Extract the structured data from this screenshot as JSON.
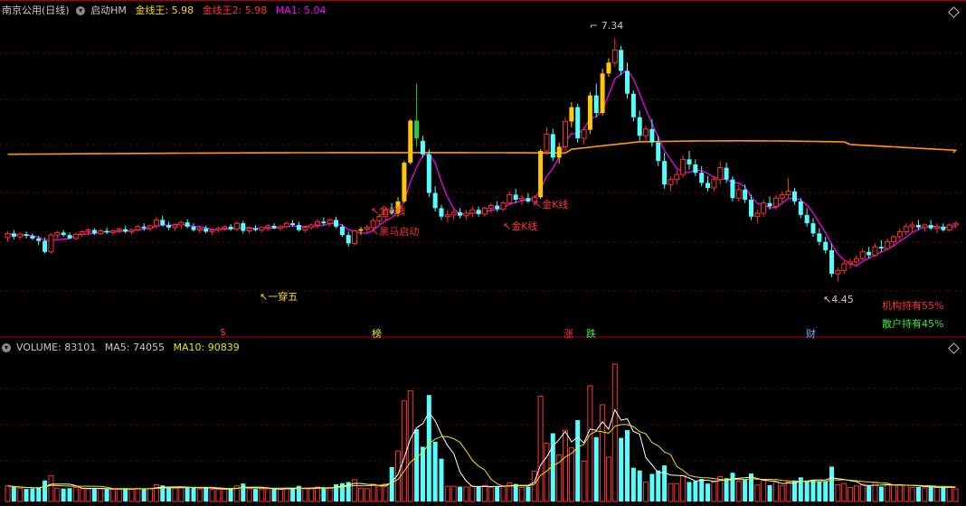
{
  "header": {
    "stock_name": "南京公用(日线)",
    "indicator_name": "启动HM",
    "jxw_label": "金线王:",
    "jxw_value": "5.98",
    "jxw2_label": "金线王2:",
    "jxw2_value": "5.98",
    "ma1_label": "MA1:",
    "ma1_value": "5.04"
  },
  "volume_header": {
    "volume_label": "VOLUME:",
    "volume_value": "83101",
    "ma5_label": "MA5:",
    "ma5_value": "74055",
    "ma10_label": "MA10:",
    "ma10_value": "90839"
  },
  "annotations": {
    "high_price": "7.34",
    "low_price": "4.45",
    "one_through_five": "一穿五",
    "gold_k_1": "金K线",
    "gold_k_2": "金K线",
    "gold_k_3": "金K线",
    "black_horse": "黑马启动"
  },
  "events": {
    "e1": "$",
    "e2": "榜",
    "e3": "涨",
    "e4": "跌",
    "e5": "财"
  },
  "holdings": {
    "institution": "机构持有55%",
    "retail": "散户持有45%"
  },
  "colors": {
    "up": "#ff3232",
    "down": "#54ffff",
    "gold": "#ffc800",
    "green_k": "#22cc44",
    "orange_line": "#ff9900",
    "ma1": "#ff00ff",
    "vol_ma5": "#ffffff",
    "vol_ma10": "#e8e800",
    "grid": "#7a0000"
  },
  "chart_data": {
    "type": "candlestick",
    "ylim": [
      4.25,
      7.6
    ],
    "candles": [
      [
        4.97,
        5.05,
        4.92,
        5.02
      ],
      [
        5.02,
        5.06,
        4.95,
        4.98
      ],
      [
        4.98,
        5.03,
        4.94,
        5.01
      ],
      [
        5.01,
        5.04,
        4.96,
        4.99
      ],
      [
        4.99,
        5.02,
        4.94,
        4.96
      ],
      [
        4.96,
        4.99,
        4.88,
        4.93
      ],
      [
        4.93,
        4.97,
        4.78,
        4.8
      ],
      [
        4.8,
        5.02,
        4.78,
        5.0
      ],
      [
        5.0,
        5.05,
        4.96,
        5.03
      ],
      [
        5.03,
        5.06,
        4.98,
        5.0
      ],
      [
        5.0,
        5.03,
        4.95,
        4.96
      ],
      [
        4.96,
        5.03,
        4.94,
        5.01
      ],
      [
        5.01,
        5.06,
        4.98,
        5.04
      ],
      [
        5.04,
        5.08,
        5.0,
        5.06
      ],
      [
        5.06,
        5.08,
        5.0,
        5.02
      ],
      [
        5.02,
        5.07,
        5.0,
        5.05
      ],
      [
        5.05,
        5.09,
        5.01,
        5.03
      ],
      [
        5.03,
        5.07,
        5.0,
        5.05
      ],
      [
        5.05,
        5.09,
        5.02,
        5.07
      ],
      [
        5.07,
        5.11,
        5.02,
        5.04
      ],
      [
        5.04,
        5.08,
        5.01,
        5.06
      ],
      [
        5.06,
        5.12,
        5.04,
        5.1
      ],
      [
        5.1,
        5.14,
        5.05,
        5.08
      ],
      [
        5.08,
        5.12,
        5.04,
        5.11
      ],
      [
        5.11,
        5.22,
        5.08,
        5.18
      ],
      [
        5.18,
        5.23,
        5.1,
        5.12
      ],
      [
        5.12,
        5.16,
        5.06,
        5.09
      ],
      [
        5.09,
        5.14,
        5.05,
        5.12
      ],
      [
        5.12,
        5.17,
        5.07,
        5.15
      ],
      [
        5.15,
        5.19,
        5.08,
        5.1
      ],
      [
        5.1,
        5.14,
        5.04,
        5.06
      ],
      [
        5.06,
        5.1,
        5.02,
        5.08
      ],
      [
        5.08,
        5.11,
        5.02,
        5.04
      ],
      [
        5.04,
        5.07,
        5.0,
        5.06
      ],
      [
        5.06,
        5.1,
        5.03,
        5.08
      ],
      [
        5.08,
        5.12,
        5.05,
        5.1
      ],
      [
        5.1,
        5.13,
        5.05,
        5.07
      ],
      [
        5.07,
        5.16,
        5.05,
        5.14
      ],
      [
        5.14,
        5.17,
        5.02,
        5.05
      ],
      [
        5.05,
        5.1,
        5.02,
        5.08
      ],
      [
        5.08,
        5.12,
        5.04,
        5.06
      ],
      [
        5.06,
        5.1,
        5.03,
        5.09
      ],
      [
        5.09,
        5.13,
        5.05,
        5.11
      ],
      [
        5.11,
        5.14,
        5.07,
        5.08
      ],
      [
        5.08,
        5.12,
        5.05,
        5.1
      ],
      [
        5.1,
        5.16,
        5.08,
        5.14
      ],
      [
        5.14,
        5.18,
        5.1,
        5.12
      ],
      [
        5.12,
        5.16,
        5.04,
        5.06
      ],
      [
        5.06,
        5.11,
        5.03,
        5.09
      ],
      [
        5.09,
        5.14,
        5.06,
        5.12
      ],
      [
        5.12,
        5.19,
        5.08,
        5.16
      ],
      [
        5.16,
        5.21,
        5.12,
        5.14
      ],
      [
        5.14,
        5.2,
        5.1,
        5.18
      ],
      [
        5.18,
        5.22,
        5.08,
        5.1
      ],
      [
        5.1,
        5.13,
        4.98,
        5.0
      ],
      [
        5.0,
        5.04,
        4.86,
        4.9
      ],
      [
        4.9,
        5.07,
        4.88,
        5.05
      ],
      [
        5.05,
        5.1,
        5.0,
        5.07
      ],
      [
        5.07,
        5.12,
        5.03,
        5.09
      ],
      [
        5.09,
        5.2,
        5.06,
        5.17
      ],
      [
        5.17,
        5.25,
        5.13,
        5.22
      ],
      [
        5.22,
        5.33,
        5.18,
        5.3
      ],
      [
        5.3,
        5.38,
        5.24,
        5.26
      ],
      [
        5.26,
        5.45,
        5.22,
        5.4
      ],
      [
        5.4,
        5.88,
        5.38,
        5.86
      ],
      [
        5.86,
        6.38,
        5.84,
        6.36
      ],
      [
        6.36,
        6.8,
        6.05,
        6.15
      ],
      [
        6.12,
        6.18,
        5.92,
        5.96
      ],
      [
        5.96,
        6.02,
        5.45,
        5.5
      ],
      [
        5.5,
        5.58,
        5.28,
        5.32
      ],
      [
        5.32,
        5.36,
        5.18,
        5.22
      ],
      [
        5.22,
        5.3,
        5.15,
        5.24
      ],
      [
        5.24,
        5.32,
        5.18,
        5.27
      ],
      [
        5.27,
        5.32,
        5.2,
        5.23
      ],
      [
        5.23,
        5.3,
        5.18,
        5.26
      ],
      [
        5.26,
        5.34,
        5.21,
        5.3
      ],
      [
        5.3,
        5.34,
        5.22,
        5.25
      ],
      [
        5.25,
        5.34,
        5.22,
        5.32
      ],
      [
        5.32,
        5.38,
        5.27,
        5.35
      ],
      [
        5.35,
        5.4,
        5.28,
        5.31
      ],
      [
        5.31,
        5.4,
        5.29,
        5.38
      ],
      [
        5.38,
        5.52,
        5.36,
        5.48
      ],
      [
        5.48,
        5.55,
        5.38,
        5.42
      ],
      [
        5.42,
        5.48,
        5.36,
        5.44
      ],
      [
        5.44,
        5.5,
        5.38,
        5.4
      ],
      [
        5.4,
        5.47,
        5.35,
        5.45
      ],
      [
        5.45,
        6.02,
        5.43,
        6.0
      ],
      [
        6.0,
        6.28,
        5.95,
        6.2
      ],
      [
        6.2,
        6.26,
        5.88,
        5.92
      ],
      [
        5.92,
        6.1,
        5.85,
        6.05
      ],
      [
        6.05,
        6.4,
        6.0,
        6.35
      ],
      [
        6.35,
        6.58,
        6.28,
        6.52
      ],
      [
        6.52,
        6.56,
        6.1,
        6.15
      ],
      [
        6.15,
        6.28,
        6.08,
        6.25
      ],
      [
        6.25,
        6.7,
        6.2,
        6.66
      ],
      [
        6.66,
        6.8,
        6.4,
        6.45
      ],
      [
        6.45,
        6.98,
        6.42,
        6.92
      ],
      [
        6.92,
        7.1,
        6.88,
        7.05
      ],
      [
        7.05,
        7.34,
        7.0,
        7.2
      ],
      [
        7.2,
        7.25,
        6.9,
        6.95
      ],
      [
        6.95,
        7.05,
        6.62,
        6.68
      ],
      [
        6.68,
        6.72,
        6.35,
        6.4
      ],
      [
        6.4,
        6.48,
        6.12,
        6.18
      ],
      [
        6.18,
        6.3,
        6.1,
        6.26
      ],
      [
        6.26,
        6.38,
        6.05,
        6.1
      ],
      [
        6.1,
        6.18,
        5.82,
        5.88
      ],
      [
        5.88,
        5.98,
        5.55,
        5.6
      ],
      [
        5.6,
        5.7,
        5.52,
        5.66
      ],
      [
        5.66,
        5.78,
        5.6,
        5.72
      ],
      [
        5.72,
        5.95,
        5.68,
        5.9
      ],
      [
        5.9,
        6.0,
        5.78,
        5.84
      ],
      [
        5.84,
        5.9,
        5.7,
        5.74
      ],
      [
        5.74,
        5.82,
        5.58,
        5.62
      ],
      [
        5.62,
        5.7,
        5.52,
        5.56
      ],
      [
        5.56,
        5.7,
        5.52,
        5.66
      ],
      [
        5.66,
        5.88,
        5.6,
        5.8
      ],
      [
        5.8,
        5.86,
        5.62,
        5.66
      ],
      [
        5.66,
        5.7,
        5.4,
        5.44
      ],
      [
        5.44,
        5.6,
        5.4,
        5.54
      ],
      [
        5.54,
        5.6,
        5.38,
        5.42
      ],
      [
        5.42,
        5.48,
        5.18,
        5.22
      ],
      [
        5.22,
        5.3,
        5.14,
        5.26
      ],
      [
        5.26,
        5.42,
        5.22,
        5.38
      ],
      [
        5.38,
        5.46,
        5.3,
        5.34
      ],
      [
        5.34,
        5.48,
        5.3,
        5.44
      ],
      [
        5.44,
        5.52,
        5.38,
        5.48
      ],
      [
        5.48,
        5.68,
        5.44,
        5.52
      ],
      [
        5.52,
        5.56,
        5.36,
        5.4
      ],
      [
        5.4,
        5.44,
        5.2,
        5.24
      ],
      [
        5.24,
        5.32,
        5.1,
        5.14
      ],
      [
        5.14,
        5.2,
        4.98,
        5.02
      ],
      [
        5.02,
        5.08,
        4.88,
        4.92
      ],
      [
        4.92,
        4.98,
        4.78,
        4.82
      ],
      [
        4.82,
        4.9,
        4.5,
        4.54
      ],
      [
        4.54,
        4.62,
        4.45,
        4.58
      ],
      [
        4.58,
        4.7,
        4.54,
        4.66
      ],
      [
        4.66,
        4.72,
        4.6,
        4.68
      ],
      [
        4.68,
        4.76,
        4.62,
        4.72
      ],
      [
        4.72,
        4.84,
        4.7,
        4.8
      ],
      [
        4.8,
        4.86,
        4.72,
        4.76
      ],
      [
        4.76,
        4.9,
        4.74,
        4.86
      ],
      [
        4.86,
        4.94,
        4.8,
        4.84
      ],
      [
        4.84,
        4.96,
        4.82,
        4.92
      ],
      [
        4.92,
        5.0,
        4.86,
        4.98
      ],
      [
        4.98,
        5.08,
        4.94,
        5.04
      ],
      [
        5.04,
        5.14,
        5.0,
        5.1
      ],
      [
        5.1,
        5.16,
        5.04,
        5.12
      ],
      [
        5.12,
        5.18,
        5.06,
        5.09
      ],
      [
        5.09,
        5.14,
        5.04,
        5.12
      ],
      [
        5.12,
        5.18,
        5.06,
        5.08
      ],
      [
        5.08,
        5.14,
        5.02,
        5.1
      ],
      [
        5.1,
        5.14,
        5.04,
        5.06
      ],
      [
        5.06,
        5.14,
        5.04,
        5.12
      ],
      [
        5.12,
        5.16,
        5.08,
        5.14
      ]
    ],
    "volume_scale": [
      0,
      300000
    ]
  }
}
